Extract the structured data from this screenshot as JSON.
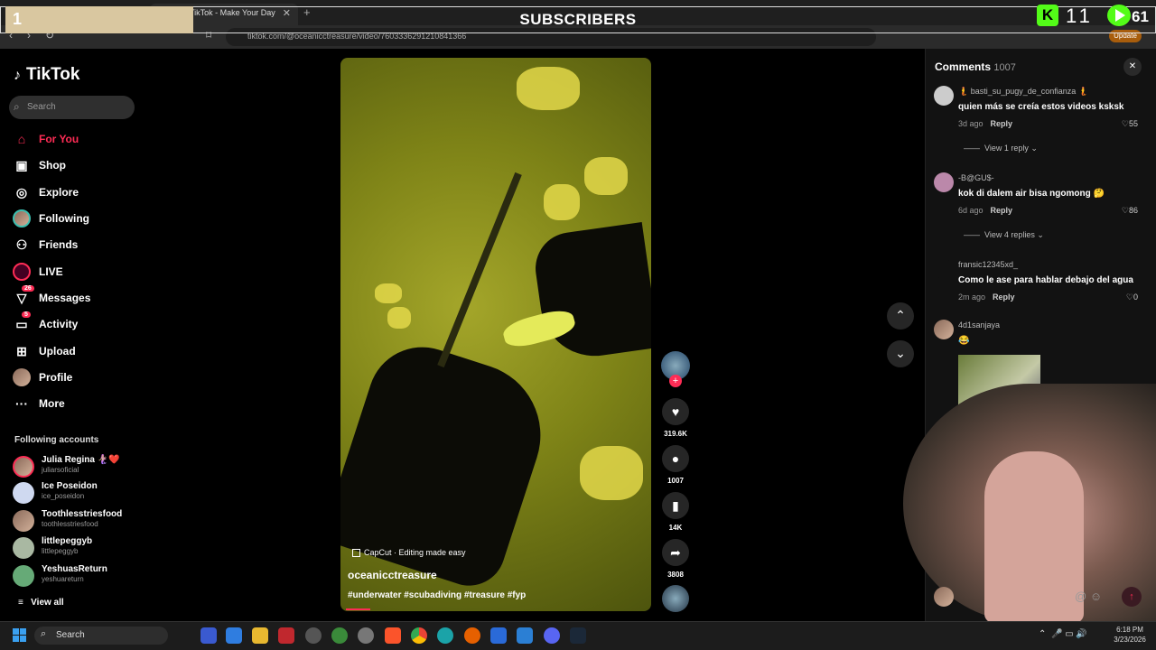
{
  "browser": {
    "tab_title": "TikTok - Make Your Day",
    "url": "tiktok.com/@oceanicctreasure/video/7603336291210841366",
    "update_label": "Update"
  },
  "overlay": {
    "left_number": "1",
    "title": "SUBSCRIBERS",
    "kick_count": "11",
    "play_count": "61"
  },
  "sidebar": {
    "logo": "TikTok",
    "search_placeholder": "Search",
    "nav": [
      {
        "label": "For You",
        "icon": "home-icon"
      },
      {
        "label": "Shop",
        "icon": "shop-icon"
      },
      {
        "label": "Explore",
        "icon": "compass-icon"
      },
      {
        "label": "Following",
        "icon": "following-avatar-icon"
      },
      {
        "label": "Friends",
        "icon": "friends-icon"
      },
      {
        "label": "LIVE",
        "icon": "live-icon"
      },
      {
        "label": "Messages",
        "icon": "messages-icon",
        "badge": "26"
      },
      {
        "label": "Activity",
        "icon": "activity-icon",
        "badge": "5"
      },
      {
        "label": "Upload",
        "icon": "upload-icon"
      },
      {
        "label": "Profile",
        "icon": "profile-avatar-icon"
      },
      {
        "label": "More",
        "icon": "more-icon"
      }
    ],
    "following_header": "Following accounts",
    "accounts": [
      {
        "name": "Julia Regina 🧜🏼‍♀️❤️",
        "handle": "juliarsoficial"
      },
      {
        "name": "Ice Poseidon",
        "handle": "ice_poseidon"
      },
      {
        "name": "Toothlesstriesfood",
        "handle": "toothlesstriesfood"
      },
      {
        "name": "littlepeggyb",
        "handle": "littlepeggyb"
      },
      {
        "name": "YeshuasReturn",
        "handle": "yeshuareturn"
      }
    ],
    "view_all": "View all"
  },
  "video": {
    "capcut_label": "CapCut · Editing made easy",
    "author": "oceanicctreasure",
    "tags": "#underwater #scubadiving #treasure #fyp",
    "likes": "319.6K",
    "comments": "1007",
    "saves": "14K",
    "shares": "3808",
    "progress": 0.08
  },
  "comments": {
    "title": "Comments",
    "count": "1007",
    "items": [
      {
        "user": "🧜 basti_su_pugy_de_confianza 🧜",
        "text": "quien más se creía estos videos ksksk",
        "age": "3d ago",
        "reply": "Reply",
        "likes": "55",
        "replies": "View 1 reply"
      },
      {
        "user": "-B@GU$-",
        "text": "kok di dalem air bisa ngomong 🤔",
        "age": "6d ago",
        "reply": "Reply",
        "likes": "86",
        "replies": "View 4 replies"
      },
      {
        "user": "fransic12345xd_",
        "text": "Como le ase para hablar debajo del agua",
        "age": "2m ago",
        "reply": "Reply",
        "likes": "0",
        "replies": ""
      },
      {
        "user": "4d1sanjaya",
        "text": "😂",
        "age": "",
        "reply": "",
        "likes": "",
        "replies": ""
      }
    ]
  },
  "taskbar": {
    "search_label": "Search",
    "time": "6:18 PM",
    "date": "3/23/2026"
  },
  "colors": {
    "accent": "#fe2c55",
    "kick_green": "#53fc18",
    "background": "#000000"
  }
}
